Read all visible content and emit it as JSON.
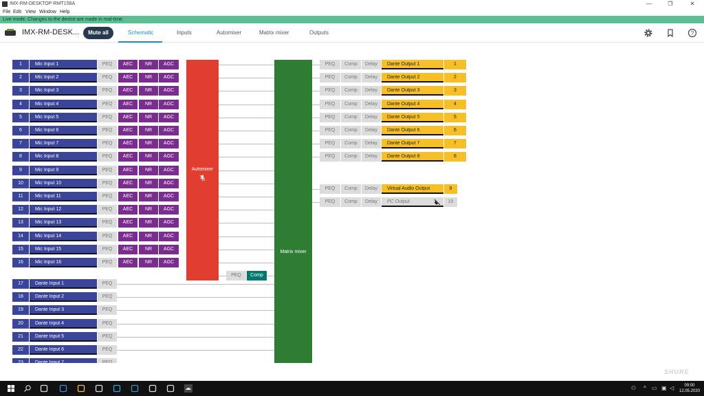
{
  "window": {
    "title": "IMX-RM-DESKTOP-RMT158A",
    "min": "—",
    "max": "❐",
    "close": "✕"
  },
  "menu": [
    "File",
    "Edit",
    "View",
    "Window",
    "Help"
  ],
  "live_banner": "Live mode. Changes to the device are made in real-time.",
  "header": {
    "device_name": "IMX-RM-DESK...",
    "mute_label": "Mute all",
    "tabs": [
      "Schematic",
      "Inputs",
      "Automixer",
      "Matrix mixer",
      "Outputs"
    ],
    "active_tab": "Schematic",
    "icons": [
      "settings-icon",
      "bookmark-icon",
      "help-icon"
    ]
  },
  "labels": {
    "peq": "PEQ",
    "aec": "AEC",
    "nr": "NR",
    "agc": "AGC",
    "comp": "Comp",
    "delay": "Delay"
  },
  "mic_inputs": [
    {
      "num": "1",
      "name": "Mic Input 1"
    },
    {
      "num": "2",
      "name": "Mic Input 2"
    },
    {
      "num": "3",
      "name": "Mic Input 3"
    },
    {
      "num": "4",
      "name": "Mic Input 4"
    },
    {
      "num": "5",
      "name": "Mic Input 5"
    },
    {
      "num": "6",
      "name": "Mic Input 6"
    },
    {
      "num": "7",
      "name": "Mic Input 7"
    },
    {
      "num": "8",
      "name": "Mic Input 8"
    },
    {
      "num": "9",
      "name": "Mic Input 9"
    },
    {
      "num": "10",
      "name": "Mic Input 10"
    },
    {
      "num": "11",
      "name": "Mic Input 11"
    },
    {
      "num": "12",
      "name": "Mic Input 12"
    },
    {
      "num": "13",
      "name": "Mic Input 13"
    },
    {
      "num": "14",
      "name": "Mic Input 14"
    },
    {
      "num": "15",
      "name": "Mic Input 15"
    },
    {
      "num": "16",
      "name": "Mic Input 16"
    }
  ],
  "dante_inputs": [
    {
      "num": "17",
      "name": "Dante Input 1"
    },
    {
      "num": "18",
      "name": "Dante Input 2"
    },
    {
      "num": "19",
      "name": "Dante Input 3"
    },
    {
      "num": "20",
      "name": "Dante Input 4"
    },
    {
      "num": "21",
      "name": "Dante Input 5"
    },
    {
      "num": "22",
      "name": "Dante Input 6"
    },
    {
      "num": "23",
      "name": "Dante Input 7"
    }
  ],
  "automixer_label": "Automixer",
  "matrix_label": "Matrix mixer",
  "dante_outputs": [
    {
      "num": "1",
      "name": "Dante Output 1"
    },
    {
      "num": "2",
      "name": "Dante Output 2"
    },
    {
      "num": "3",
      "name": "Dante Output 3"
    },
    {
      "num": "4",
      "name": "Dante Output 4"
    },
    {
      "num": "5",
      "name": "Dante Output 5"
    },
    {
      "num": "6",
      "name": "Dante Output 6"
    },
    {
      "num": "7",
      "name": "Dante Output 7"
    },
    {
      "num": "8",
      "name": "Dante Output 8"
    }
  ],
  "virtual_output": {
    "num": "9",
    "name": "Virtual Audio Output"
  },
  "pc_output": {
    "num": "10",
    "name": "PC Output"
  },
  "brand": "SHURE",
  "taskbar": {
    "time": "09:00",
    "date": "12.05.2020",
    "apps": [
      "start-icon",
      "search-icon",
      "task-view-icon",
      "edge-icon",
      "file-explorer-icon",
      "store-icon",
      "app-l-icon",
      "mail-icon",
      "snip-icon",
      "settings-icon",
      "shure-designer-icon"
    ]
  },
  "colors": {
    "input_blue": "#3a4498",
    "dsp_purple": "#7b2c8f",
    "automixer_red": "#e23e30",
    "matrix_green": "#2e7d32",
    "output_yellow": "#f6bf26",
    "live_green": "#5ebd93",
    "comp_teal": "#00786b"
  }
}
